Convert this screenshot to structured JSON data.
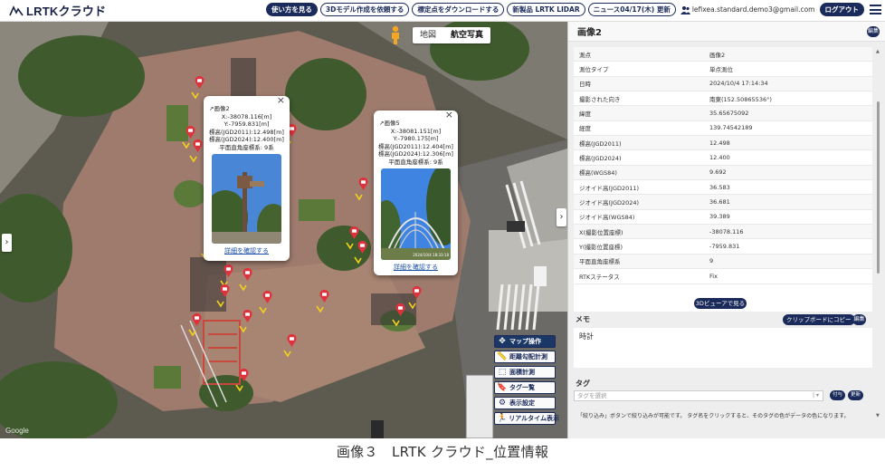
{
  "header": {
    "logo": "LRTKクラウド",
    "links": [
      {
        "label": "使い方を見る",
        "style": "dark"
      },
      {
        "label": "3Dモデル作成を依頼する",
        "style": "outline"
      },
      {
        "label": "標定点をダウンロードする",
        "style": "outline"
      },
      {
        "label": "新製品 LRTK LIDAR",
        "style": "outline"
      },
      {
        "label": "ニュース04/17(木) 更新",
        "style": "outline"
      }
    ],
    "user_email": "lefixea.standard.demo3@gmail.com",
    "logout_label": "ログアウト"
  },
  "map": {
    "toggle": {
      "map_label": "地図",
      "aerial_label": "航空写真",
      "active": "航空写真"
    },
    "google_label": "Google",
    "popups": [
      {
        "title": "画像2",
        "lines": [
          "X:-38078.116[m]",
          "Y:-7959.831[m]",
          "標高(JGD2011):12.498[m]",
          "標高(JGD2024):12.400[m]",
          "平面直角座標系: 9系"
        ],
        "link": "詳細を確認する"
      },
      {
        "title": "画像5",
        "lines": [
          "X:-38081.151[m]",
          "Y:-7980.175[m]",
          "標高(JGD2011):12.404[m]",
          "標高(JGD2024):12.306[m]",
          "平面直角座標系: 9系"
        ],
        "photo_timestamp": "2024/10/4 18:33:18",
        "link": "詳細を確認する"
      }
    ],
    "tools": [
      {
        "label": "マップ操作",
        "icon": "move-icon",
        "active": true
      },
      {
        "label": "距離勾配計測",
        "icon": "ruler-icon",
        "active": false
      },
      {
        "label": "面積計測",
        "icon": "area-icon",
        "active": false
      },
      {
        "label": "タグ一覧",
        "icon": "bookmark-icon",
        "active": false
      },
      {
        "label": "表示設定",
        "icon": "gear-icon",
        "active": false
      },
      {
        "label": "リアルタイム表示",
        "icon": "running-icon",
        "active": false
      }
    ]
  },
  "panel": {
    "title": "画像2",
    "edit_label": "編集",
    "rows": [
      {
        "key": "測点",
        "value": "画像2"
      },
      {
        "key": "測位タイプ",
        "value": "単点測位"
      },
      {
        "key": "日時",
        "value": "2024/10/4 17:14:34"
      },
      {
        "key": "撮影された向き",
        "value": "南東(152.50865536°)"
      },
      {
        "key": "緯度",
        "value": "35.65675092"
      },
      {
        "key": "経度",
        "value": "139.74542189"
      },
      {
        "key": "標高(JGD2011)",
        "value": "12.498"
      },
      {
        "key": "標高(JGD2024)",
        "value": "12.400"
      },
      {
        "key": "標高(WGS84)",
        "value": "9.692"
      },
      {
        "key": "ジオイド高(JGD2011)",
        "value": "36.583"
      },
      {
        "key": "ジオイド高(JGD2024)",
        "value": "36.681"
      },
      {
        "key": "ジオイド高(WGS84)",
        "value": "39.389"
      },
      {
        "key": "X(撮影位置座標)",
        "value": "-38078.116"
      },
      {
        "key": "Y(撮影位置座標)",
        "value": "-7959.831"
      },
      {
        "key": "平面直角座標系",
        "value": "9"
      },
      {
        "key": "RTKステータス",
        "value": "Fix"
      }
    ],
    "viewer_button": "3Dビューアで見る",
    "memo": {
      "label": "メモ",
      "copy_label": "クリップボードにコピー",
      "edit_label": "編集",
      "text": "時計"
    },
    "tags": {
      "label": "タグ",
      "placeholder": "タグを選択",
      "add_label": "付与",
      "update_label": "更新",
      "hint": "「絞り込み」ボタンで絞り込みが可能です。 タグ名をクリックすると、そのタグの色がデータの色になります。"
    }
  },
  "caption": "画像３　LRTK クラウド_位置情報",
  "colors": {
    "accent": "#1a2a5a",
    "pin": "#e0323c",
    "arrow": "#f2d11b"
  }
}
